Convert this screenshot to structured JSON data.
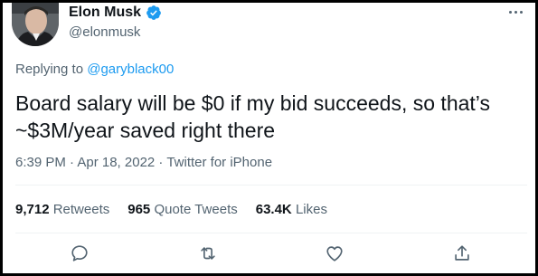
{
  "author": {
    "name": "Elon Musk",
    "handle": "@elonmusk",
    "avatar_icon": "profile-photo",
    "verified_icon": "verified-badge-icon"
  },
  "reply": {
    "prefix": "Replying to",
    "mention": "@garyblack00"
  },
  "tweet": {
    "text": "Board salary will be $0 if my bid succeeds, so that’s ~$3M/year saved right there",
    "meta": "6:39 PM · Apr 18, 2022 · Twitter for iPhone"
  },
  "stats": {
    "retweets_count": "9,712",
    "retweets_label": "Retweets",
    "quotes_count": "965",
    "quotes_label": "Quote Tweets",
    "likes_count": "63.4K",
    "likes_label": "Likes"
  },
  "actions": {
    "reply_icon": "reply-icon",
    "retweet_icon": "retweet-icon",
    "like_icon": "like-icon",
    "share_icon": "share-icon"
  },
  "colors": {
    "accent": "#1d9bf0",
    "text": "#0f1419",
    "secondary": "#536471"
  }
}
